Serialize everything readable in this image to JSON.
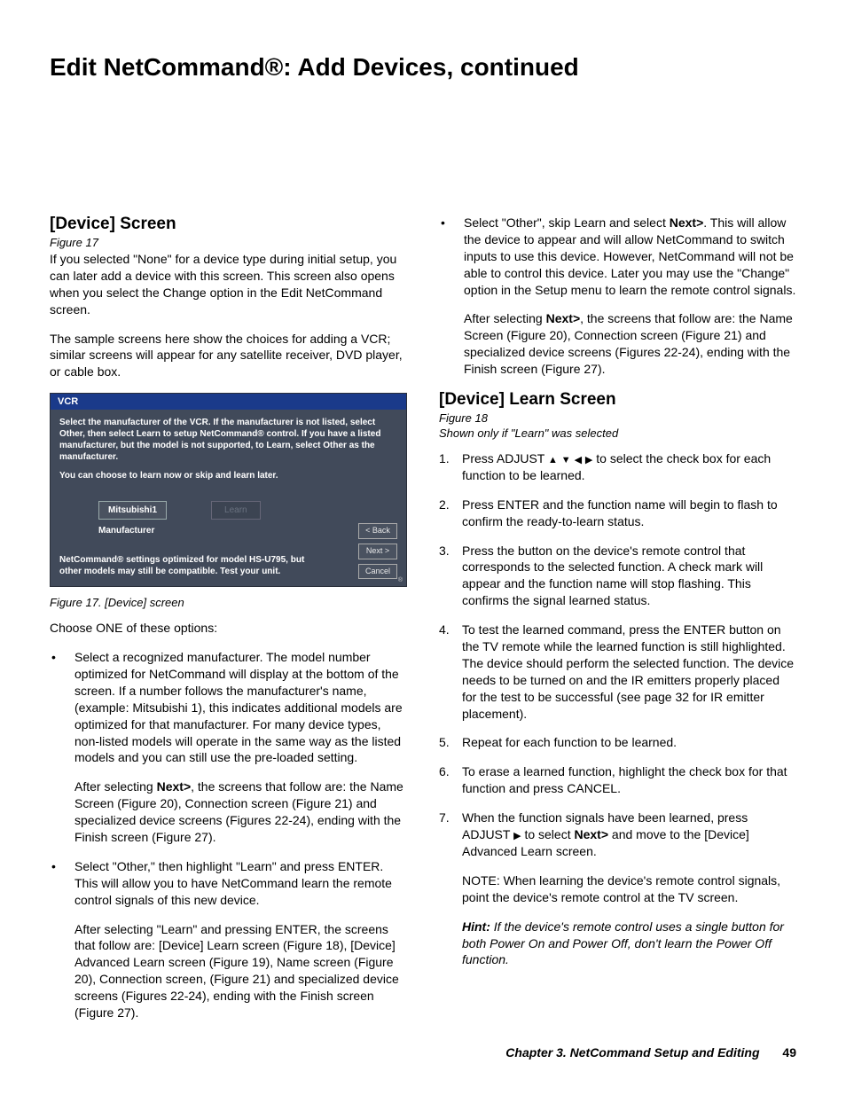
{
  "page_title": "Edit NetCommand®:  Add Devices, continued",
  "left": {
    "heading": "[Device] Screen",
    "fig_ref": "Figure 17",
    "p1": "If you selected \"None\" for a device type during initial setup, you can later add a device with this screen.  This screen also opens when you select the Change option in the Edit NetCommand screen.",
    "p2": "The sample screens here show the choices for adding a VCR; similar screens will appear for any satellite receiver, DVD player, or cable box.",
    "screenshot": {
      "title": "VCR",
      "instructions": "Select the manufacturer of the VCR.   If the manufacturer is not listed, select Other, then select Learn to setup NetCommand® control. If you have a listed manufacturer, but the model is not supported, to Learn, select Other as the manufacturer.",
      "sub": "You can choose to learn now or skip and learn later.",
      "field_value": "Mitsubishi1",
      "learn_label": "Learn",
      "field_label": "Manufacturer",
      "footer_note": "NetCommand® settings optimized for model HS-U795, but other models may still be compatible. Test your unit.",
      "nav_back": "< Back",
      "nav_next": "Next >",
      "nav_cancel": "Cancel"
    },
    "fig_caption": "Figure 17.  [Device] screen",
    "choose": "Choose ONE of these options:",
    "b1": "Select a recognized manufacturer.  The model number optimized for NetCommand will display at the bottom of the screen. If a number follows the manufacturer's name, (example: Mitsubishi 1), this indicates additional models are optimized for that manufacturer.  For many device types, non-listed models will operate in the same way as the listed models and you can still use the pre-loaded setting.",
    "b1_after_pre": "After selecting ",
    "b1_after_bold": "Next>",
    "b1_after_post": ", the screens that follow are: the Name Screen (Figure 20), Connection screen (Figure 21) and specialized device screens (Figures 22-24), ending with the Finish screen (Figure 27).",
    "b2": "Select \"Other,\" then highlight \"Learn\" and press ENTER.  This will allow you to have NetCommand learn the remote control signals of this new device.",
    "b2_after": "After selecting \"Learn\" and pressing ENTER, the screens that follow are:  [Device] Learn screen (Figure 18), [Device] Advanced Learn screen (Figure 19), Name screen (Figure 20), Connection screen, (Figure 21) and specialized device screens (Figures 22-24), ending with the Finish screen (Figure 27)."
  },
  "right": {
    "b3_pre": "Select \"Other\", skip Learn and select ",
    "b3_bold": "Next>",
    "b3_post": ".  This will allow the device to appear and will allow NetCommand to switch inputs to use this device.  However, NetCommand will not be able to control this device.  Later you may use the \"Change\" option in the Setup menu to learn the remote control signals.",
    "b3_after_pre": "After selecting ",
    "b3_after_bold": "Next>",
    "b3_after_post": ", the screens that follow are: the Name Screen (Figure 20), Connection screen (Figure 21) and specialized device screens (Figures 22-24), ending with the Finish screen (Figure 27).",
    "heading2": "[Device] Learn Screen",
    "fig_ref2": "Figure 18",
    "shown": "Shown only if \"Learn\" was selected",
    "n1_pre": "Press ADJUST ",
    "n1_post": " to select the check box for each function to be learned.",
    "n2": "Press ENTER and the function name will begin to flash to confirm the ready-to-learn status.",
    "n3": "Press the button on the device's remote control that corresponds to the selected function.  A check mark will appear and the function name will stop flashing.  This confirms the signal learned status.",
    "n4": "To test the learned command, press the ENTER button on the TV remote while the learned function is still highlighted.  The device should perform the selected function.  The device needs to be turned on and the IR emitters properly placed for the test to be successful (see page 32 for IR emitter placement).",
    "n5": "Repeat for each function to be learned.",
    "n6": "To erase a learned function, highlight the check box for that function and press CANCEL.",
    "n7_pre": "When the function signals have been learned, press ADJUST  ",
    "n7_mid": " to select ",
    "n7_bold": "Next>",
    "n7_post": " and move to the [Device] Advanced Learn screen.",
    "note": "NOTE: When learning the device's remote control signals, point the device's remote control at the TV screen.",
    "hint_label": "Hint:",
    "hint_text": "  If the device's remote control uses a single button for both Power On and Power Off, don't learn the Power Off function."
  },
  "footer": {
    "chapter": "Chapter 3. NetCommand Setup and Editing",
    "page": "49"
  }
}
